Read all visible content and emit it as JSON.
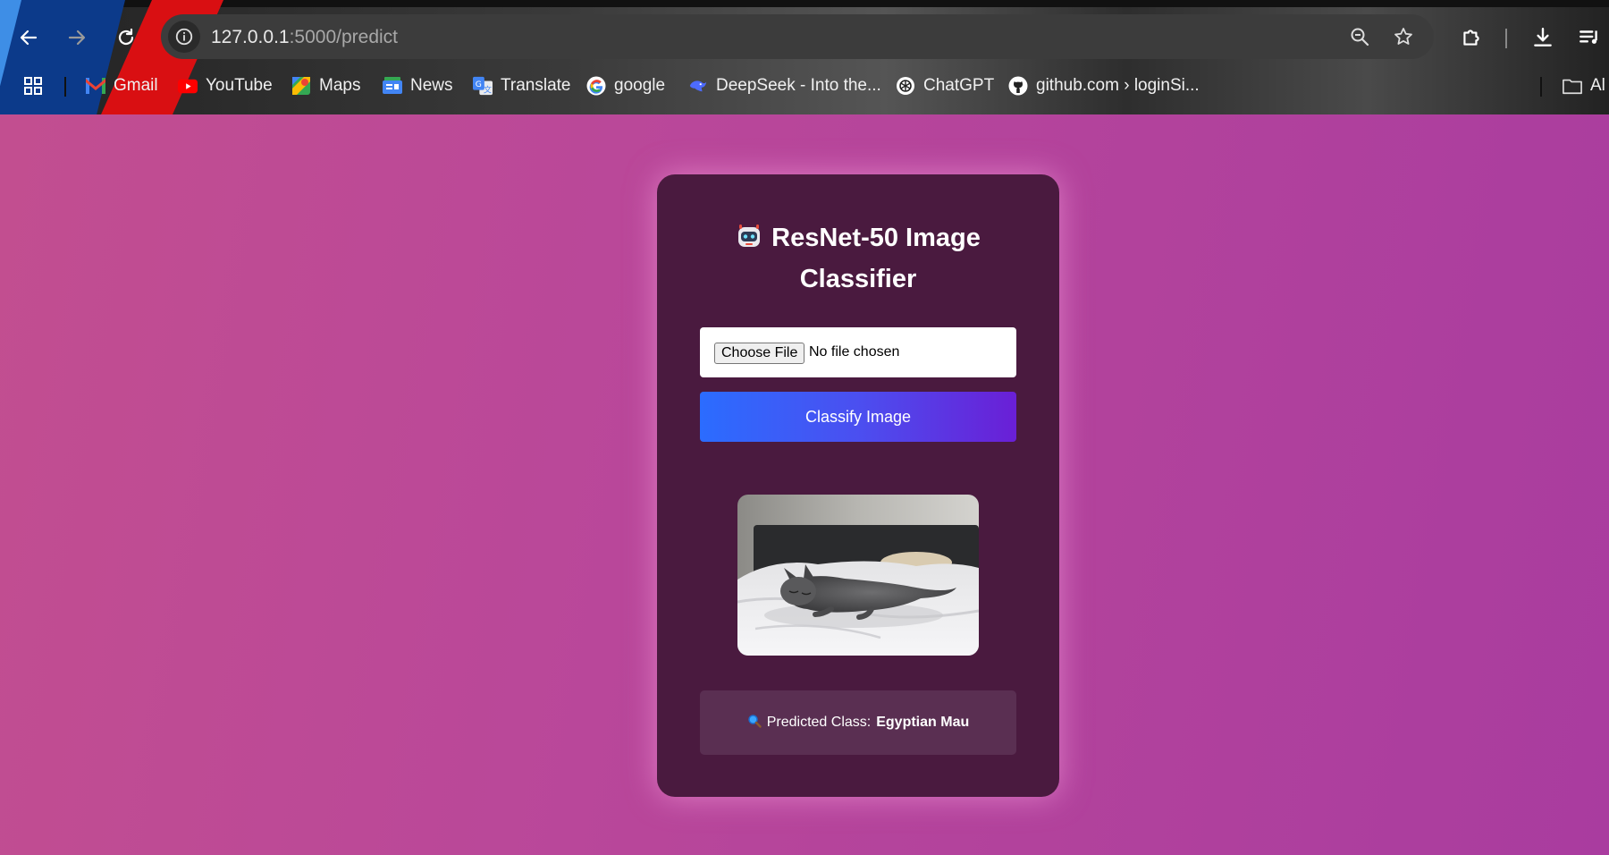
{
  "browser": {
    "url_host": "127.0.0.1",
    "url_rest": ":5000/predict",
    "bookmarks": [
      {
        "label": "Gmail",
        "icon": "gmail-icon"
      },
      {
        "label": "YouTube",
        "icon": "youtube-icon"
      },
      {
        "label": "Maps",
        "icon": "maps-icon"
      },
      {
        "label": "News",
        "icon": "news-icon"
      },
      {
        "label": "Translate",
        "icon": "translate-icon"
      },
      {
        "label": "google",
        "icon": "google-icon"
      },
      {
        "label": "DeepSeek - Into the...",
        "icon": "deepseek-icon"
      },
      {
        "label": "ChatGPT",
        "icon": "chatgpt-icon"
      },
      {
        "label": "github.com › loginSi...",
        "icon": "github-icon"
      }
    ],
    "bookmarks_folder": "Al"
  },
  "app": {
    "title_line1": "ResNet-50 Image",
    "title_line2": "Classifier",
    "title_icon": "robot-icon",
    "choose_file_label": "Choose File",
    "no_file_label": "No file chosen",
    "classify_label": "Classify Image",
    "preview_icon": "cat-photo",
    "result_prefix": "Predicted Class:",
    "result_value": "Egyptian Mau",
    "result_icon": "magnifier-icon"
  },
  "colors": {
    "page_bg": "#b9479a",
    "card_bg": "#4a1a3f",
    "button_gradient_start": "#2b6cff",
    "button_gradient_end": "#6a1fd6",
    "result_bg": "#5a2f52"
  }
}
